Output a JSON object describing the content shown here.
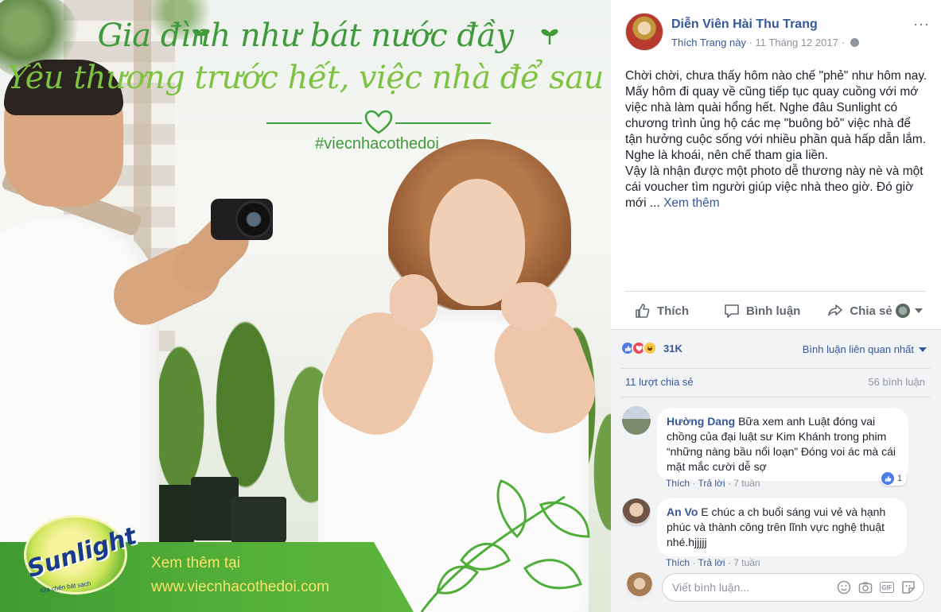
{
  "photo": {
    "headline_1": "Gia đình như bát nước đầy",
    "headline_2": "Yêu thương trước hết, việc nhà để sau",
    "hashtag": "#viecnhacothedoi",
    "brand": "Sunlight",
    "brand_tagline": "rửa chén bát sạch",
    "banner_see_more": "Xem thêm tại",
    "banner_url": "www.viecnhacothedoi.com",
    "colors": {
      "green_dark": "#3f9a3b",
      "green_light": "#7ec241",
      "banner_text": "#f6e46a"
    }
  },
  "post": {
    "page_name": "Diễn Viên Hài Thu Trang",
    "follow_label": "Thích Trang này",
    "separator": " · ",
    "date": "11 Tháng 12 2017",
    "privacy_icon": "globe-icon",
    "more_icon": "···",
    "text_paragraph_1": "Chời chời, chưa thấy hôm nào chế \"phẻ\" như hôm nay. Mấy hôm đi quay về cũng tiếp tục quay cuồng với mớ việc nhà làm quài hổng hết. Nghe đâu Sunlight có chương trình ủng hộ các mẹ \"buông bỏ\" việc nhà để tận hưởng cuộc sống với nhiều phần quà hấp dẫn lắm. Nghe là khoái, nên chế tham gia liền.",
    "text_paragraph_2": "Vậy là nhận được một photo dễ thương này nè và một cái voucher tìm người giúp việc nhà theo giờ. Đó giờ mới ...",
    "see_more": "Xem thêm"
  },
  "actions": {
    "like": "Thích",
    "comment": "Bình luận",
    "share": "Chia sẻ"
  },
  "stats": {
    "reaction_count": "31K",
    "sort_label": "Bình luận liên quan nhất",
    "shares": "11 lượt chia sẻ",
    "comments": "56 bình luận"
  },
  "comments": [
    {
      "name": "Hường Dang",
      "text": "Bữa xem anh Luật đóng vai chồng của đại luật sư Kim Khánh trong phim “những nàng bầu nổi loạn” Đóng voi ác mà cái mặt mắc cười dễ sợ",
      "like": "Thích",
      "reply": "Trả lời",
      "time": "7 tuần",
      "like_count": "1"
    },
    {
      "name": "An Vo",
      "text": "E chúc a ch buổi sáng vui vẻ và hạnh phúc và thành công trên lĩnh vực nghệ thuật nhé.hjjjjj",
      "like": "Thích",
      "reply": "Trả lời",
      "time": "7 tuần"
    }
  ],
  "compose": {
    "placeholder": "Viết bình luận..."
  },
  "colors": {
    "link": "#365899",
    "muted": "#90949c",
    "comments_bg": "#f2f3f5"
  }
}
